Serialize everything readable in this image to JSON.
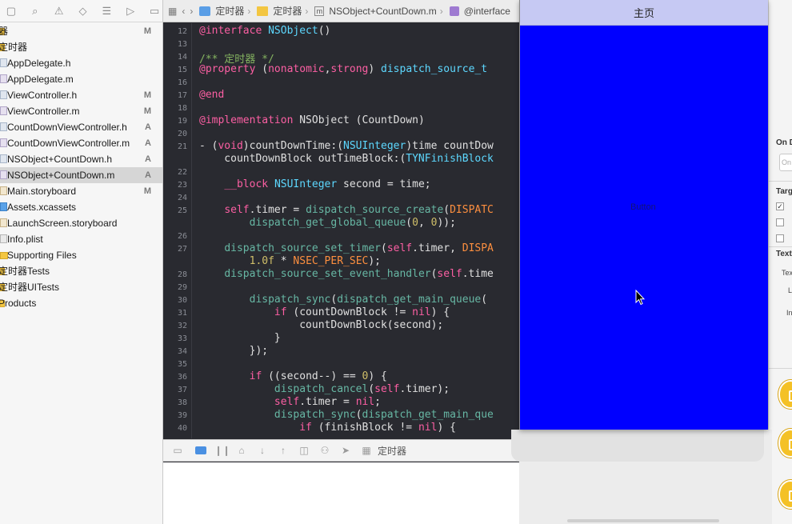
{
  "navigator": {
    "files": [
      {
        "name": "器",
        "status": "M",
        "icon": "project",
        "indent": 0,
        "selected": false
      },
      {
        "name": "定时器",
        "status": "",
        "icon": "folder",
        "indent": 0,
        "selected": false
      },
      {
        "name": "AppDelegate.h",
        "status": "",
        "icon": "header",
        "indent": 1,
        "selected": false
      },
      {
        "name": "AppDelegate.m",
        "status": "",
        "icon": "source",
        "indent": 1,
        "selected": false
      },
      {
        "name": "ViewController.h",
        "status": "M",
        "icon": "header",
        "indent": 1,
        "selected": false
      },
      {
        "name": "ViewController.m",
        "status": "M",
        "icon": "source",
        "indent": 1,
        "selected": false
      },
      {
        "name": "CountDownViewController.h",
        "status": "A",
        "icon": "header",
        "indent": 1,
        "selected": false
      },
      {
        "name": "CountDownViewController.m",
        "status": "A",
        "icon": "source",
        "indent": 1,
        "selected": false
      },
      {
        "name": "NSObject+CountDown.h",
        "status": "A",
        "icon": "header",
        "indent": 1,
        "selected": false
      },
      {
        "name": "NSObject+CountDown.m",
        "status": "A",
        "icon": "source",
        "indent": 1,
        "selected": true
      },
      {
        "name": "Main.storyboard",
        "status": "M",
        "icon": "storyboard",
        "indent": 1,
        "selected": false
      },
      {
        "name": "Assets.xcassets",
        "status": "",
        "icon": "assets",
        "indent": 1,
        "selected": false
      },
      {
        "name": "LaunchScreen.storyboard",
        "status": "",
        "icon": "storyboard",
        "indent": 1,
        "selected": false
      },
      {
        "name": "Info.plist",
        "status": "",
        "icon": "plist",
        "indent": 1,
        "selected": false
      },
      {
        "name": "Supporting Files",
        "status": "",
        "icon": "folder",
        "indent": 1,
        "selected": false
      },
      {
        "name": "定时器Tests",
        "status": "",
        "icon": "folder",
        "indent": 0,
        "selected": false
      },
      {
        "name": "定时器UITests",
        "status": "",
        "icon": "folder",
        "indent": 0,
        "selected": false
      },
      {
        "name": "Products",
        "status": "",
        "icon": "folder",
        "indent": 0,
        "selected": false
      }
    ]
  },
  "jumpbar": {
    "crumbs": [
      "定时器",
      "定时器",
      "NSObject+CountDown.m",
      "@interface"
    ]
  },
  "code": {
    "lines": [
      {
        "num": "12",
        "tokens": [
          [
            "kw",
            "@interface "
          ],
          [
            "ty",
            "NSObject"
          ],
          [
            "",
            "()"
          ]
        ]
      },
      {
        "num": "13",
        "tokens": []
      },
      {
        "num": "14",
        "tokens": [
          [
            "cm",
            "/** 定时器 */"
          ]
        ]
      },
      {
        "num": "15",
        "tokens": [
          [
            "kw",
            "@property "
          ],
          [
            "",
            "("
          ],
          [
            "kw",
            "nonatomic"
          ],
          [
            "",
            ","
          ],
          [
            "kw",
            "strong"
          ],
          [
            "",
            ") "
          ],
          [
            "ty",
            "dispatch_source_t"
          ]
        ]
      },
      {
        "num": "16",
        "tokens": []
      },
      {
        "num": "17",
        "tokens": [
          [
            "kw",
            "@end"
          ]
        ]
      },
      {
        "num": "18",
        "tokens": []
      },
      {
        "num": "19",
        "tokens": [
          [
            "kw",
            "@implementation "
          ],
          [
            "",
            "NSObject (CountDown)"
          ]
        ]
      },
      {
        "num": "20",
        "tokens": []
      },
      {
        "num": "21",
        "tokens": [
          [
            "",
            "- ("
          ],
          [
            "kw",
            "void"
          ],
          [
            "",
            ")countDownTime:("
          ],
          [
            "ty",
            "NSUInteger"
          ],
          [
            "",
            ")time countDow"
          ]
        ]
      },
      {
        "num": "",
        "tokens": [
          [
            "",
            "    countDownBlock outTimeBlock:("
          ],
          [
            "ty",
            "TYNFinishBlock"
          ]
        ]
      },
      {
        "num": "22",
        "tokens": []
      },
      {
        "num": "23",
        "tokens": [
          [
            "",
            "    "
          ],
          [
            "kw",
            "__block "
          ],
          [
            "ty",
            "NSUInteger"
          ],
          [
            "",
            " second = time;"
          ]
        ]
      },
      {
        "num": "24",
        "tokens": []
      },
      {
        "num": "25",
        "tokens": [
          [
            "",
            "    "
          ],
          [
            "kw",
            "self"
          ],
          [
            "",
            ".timer = "
          ],
          [
            "fn",
            "dispatch_source_create"
          ],
          [
            "",
            "("
          ],
          [
            "mc",
            "DISPATC"
          ]
        ]
      },
      {
        "num": "",
        "tokens": [
          [
            "",
            "        "
          ],
          [
            "fn",
            "dispatch_get_global_queue"
          ],
          [
            "",
            "("
          ],
          [
            "nm",
            "0"
          ],
          [
            "",
            ", "
          ],
          [
            "nm",
            "0"
          ],
          [
            "",
            "));"
          ]
        ]
      },
      {
        "num": "26",
        "tokens": []
      },
      {
        "num": "27",
        "tokens": [
          [
            "",
            "    "
          ],
          [
            "fn",
            "dispatch_source_set_timer"
          ],
          [
            "",
            "("
          ],
          [
            "kw",
            "self"
          ],
          [
            "",
            ".timer, "
          ],
          [
            "mc",
            "DISPA"
          ]
        ]
      },
      {
        "num": "",
        "tokens": [
          [
            "",
            "        "
          ],
          [
            "nm",
            "1.0f"
          ],
          [
            "",
            " * "
          ],
          [
            "mc",
            "NSEC_PER_SEC"
          ],
          [
            "",
            ");"
          ]
        ]
      },
      {
        "num": "28",
        "tokens": [
          [
            "",
            "    "
          ],
          [
            "fn",
            "dispatch_source_set_event_handler"
          ],
          [
            "",
            "("
          ],
          [
            "kw",
            "self"
          ],
          [
            "",
            ".time"
          ]
        ]
      },
      {
        "num": "29",
        "tokens": []
      },
      {
        "num": "30",
        "tokens": [
          [
            "",
            "        "
          ],
          [
            "fn",
            "dispatch_sync"
          ],
          [
            "",
            "("
          ],
          [
            "fn",
            "dispatch_get_main_queue"
          ],
          [
            "",
            "("
          ]
        ]
      },
      {
        "num": "31",
        "tokens": [
          [
            "",
            "            "
          ],
          [
            "kw",
            "if"
          ],
          [
            "",
            " (countDownBlock != "
          ],
          [
            "kw",
            "nil"
          ],
          [
            "",
            ") {"
          ]
        ]
      },
      {
        "num": "32",
        "tokens": [
          [
            "",
            "                countDownBlock(second);"
          ]
        ]
      },
      {
        "num": "33",
        "tokens": [
          [
            "",
            "            }"
          ]
        ]
      },
      {
        "num": "34",
        "tokens": [
          [
            "",
            "        });"
          ]
        ]
      },
      {
        "num": "35",
        "tokens": []
      },
      {
        "num": "36",
        "tokens": [
          [
            "",
            "        "
          ],
          [
            "kw",
            "if"
          ],
          [
            "",
            " ((second--) == "
          ],
          [
            "nm",
            "0"
          ],
          [
            "",
            ") {"
          ]
        ]
      },
      {
        "num": "37",
        "tokens": [
          [
            "",
            "            "
          ],
          [
            "fn",
            "dispatch_cancel"
          ],
          [
            "",
            "("
          ],
          [
            "kw",
            "self"
          ],
          [
            "",
            ".timer);"
          ]
        ]
      },
      {
        "num": "38",
        "tokens": [
          [
            "",
            "            "
          ],
          [
            "kw",
            "self"
          ],
          [
            "",
            ".timer = "
          ],
          [
            "kw",
            "nil"
          ],
          [
            "",
            ";"
          ]
        ]
      },
      {
        "num": "39",
        "tokens": [
          [
            "",
            "            "
          ],
          [
            "fn",
            "dispatch_sync"
          ],
          [
            "",
            "("
          ],
          [
            "fn",
            "dispatch_get_main_que"
          ]
        ]
      },
      {
        "num": "40",
        "tokens": [
          [
            "",
            "                "
          ],
          [
            "kw",
            "if"
          ],
          [
            "",
            " (finishBlock != "
          ],
          [
            "kw",
            "nil"
          ],
          [
            "",
            ") {"
          ]
        ]
      }
    ]
  },
  "debugbar": {
    "target_label": "定时器"
  },
  "simulator": {
    "nav_title": "主页",
    "button_label": "Button",
    "background": "#0000ff"
  },
  "inspector": {
    "on_label": "On D",
    "placeholder": "On",
    "target_label": "Targ",
    "text_label": "Text",
    "text_sub": "Tex",
    "l_label": "L",
    "in_label": "In"
  },
  "colors": {
    "keyword": "#fc5fa3",
    "type": "#5dd8ff",
    "function": "#67b7a4",
    "comment": "#84b360",
    "macro": "#fd8f3f",
    "number": "#d0bf69",
    "editor_bg": "#292a30"
  }
}
